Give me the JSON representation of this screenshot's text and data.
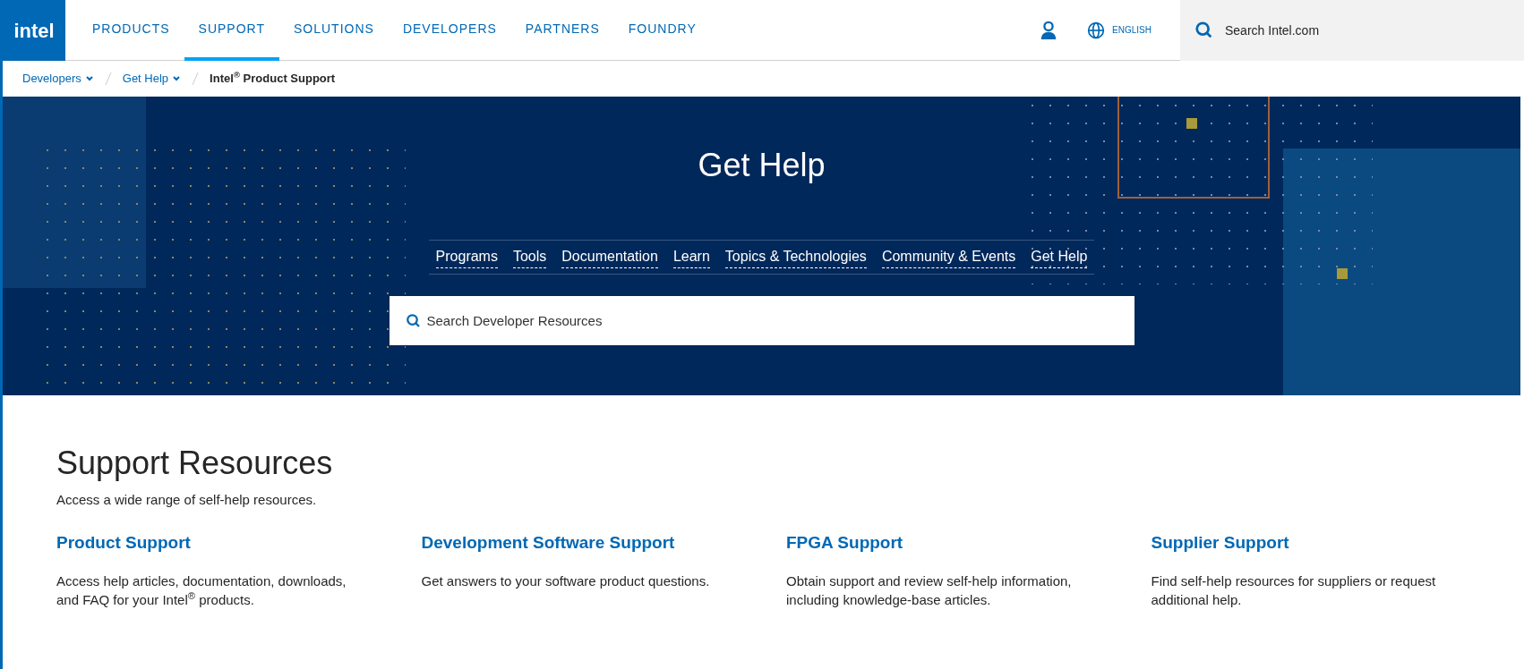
{
  "header": {
    "logo": "intel",
    "nav": [
      {
        "label": "PRODUCTS",
        "selected": false
      },
      {
        "label": "SUPPORT",
        "selected": true
      },
      {
        "label": "SOLUTIONS",
        "selected": false
      },
      {
        "label": "DEVELOPERS",
        "selected": false
      },
      {
        "label": "PARTNERS",
        "selected": false
      },
      {
        "label": "FOUNDRY",
        "selected": false
      }
    ],
    "language": "ENGLISH",
    "search": {
      "placeholder": "Search Intel.com"
    }
  },
  "breadcrumbs": [
    {
      "label": "Developers",
      "kind": "dropdown"
    },
    {
      "label": "Get Help",
      "kind": "dropdown"
    },
    {
      "label": "Intel$^{®}$ Product Support",
      "kind": "current"
    }
  ],
  "hero": {
    "title": "Get Help",
    "links": [
      "Programs",
      "Tools",
      "Documentation",
      "Learn",
      "Topics & Technologies",
      "Community & Events",
      "Get Help"
    ],
    "search": {
      "placeholder": "Search Developer Resources"
    }
  },
  "resources": {
    "title": "Support Resources",
    "subtitle": "Access a wide range of self-help resources.",
    "cards": [
      {
        "title": "Product Support",
        "text": "Access help articles, documentation, downloads, and FAQ for your Intel$^{®}$ products."
      },
      {
        "title": "Development Software Support",
        "text": "Get answers to your software product questions."
      },
      {
        "title": "FPGA Support",
        "text": "Obtain support and review self-help information, including knowledge-base articles."
      },
      {
        "title": "Supplier Support",
        "text": "Find self-help resources for suppliers or request additional help."
      }
    ]
  }
}
